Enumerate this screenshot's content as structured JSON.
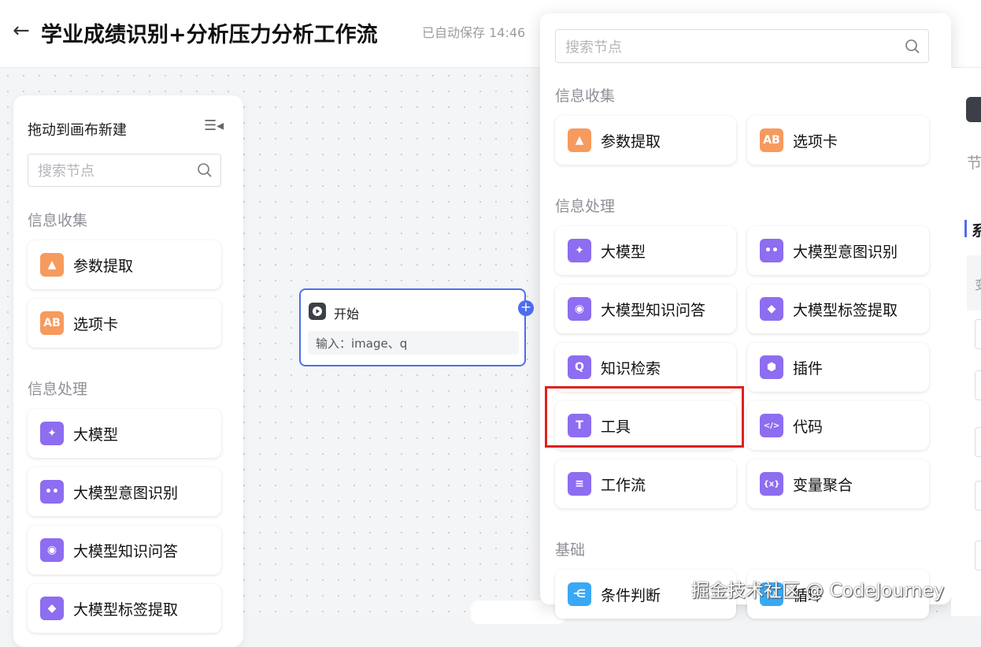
{
  "header": {
    "title": "学业成绩识别+分析压力分析工作流",
    "saved": "已自动保存 14:46"
  },
  "left_panel": {
    "title": "拖动到画布新建",
    "search_placeholder": "搜索节点",
    "sections": [
      {
        "label": "信息收集",
        "items": [
          "参数提取",
          "选项卡"
        ]
      },
      {
        "label": "信息处理",
        "items": [
          "大模型",
          "大模型意图识别",
          "大模型知识问答",
          "大模型标签提取"
        ]
      }
    ]
  },
  "node": {
    "title": "开始",
    "inputs": "输入：image、q"
  },
  "popup": {
    "search_placeholder": "搜索节点",
    "sections": [
      {
        "label": "信息收集",
        "items": [
          "参数提取",
          "选项卡"
        ]
      },
      {
        "label": "信息处理",
        "items": [
          "大模型",
          "大模型意图识别",
          "大模型知识问答",
          "大模型标签提取",
          "知识检索",
          "插件",
          "工具",
          "代码",
          "工作流",
          "变量聚合"
        ]
      },
      {
        "label": "基础",
        "items": [
          "条件判断",
          "循环"
        ]
      }
    ],
    "highlighted": "工具"
  },
  "right_panel": {
    "label1": "节",
    "label2": "系",
    "label3": "变"
  },
  "watermark": "掘金技术社区 @ CodeJourney",
  "colors": {
    "collect": "#f79a5e",
    "process": "#8d6df0",
    "basic": "#3aa8f5",
    "accent": "#4d6ef0",
    "highlight": "#e02020"
  }
}
